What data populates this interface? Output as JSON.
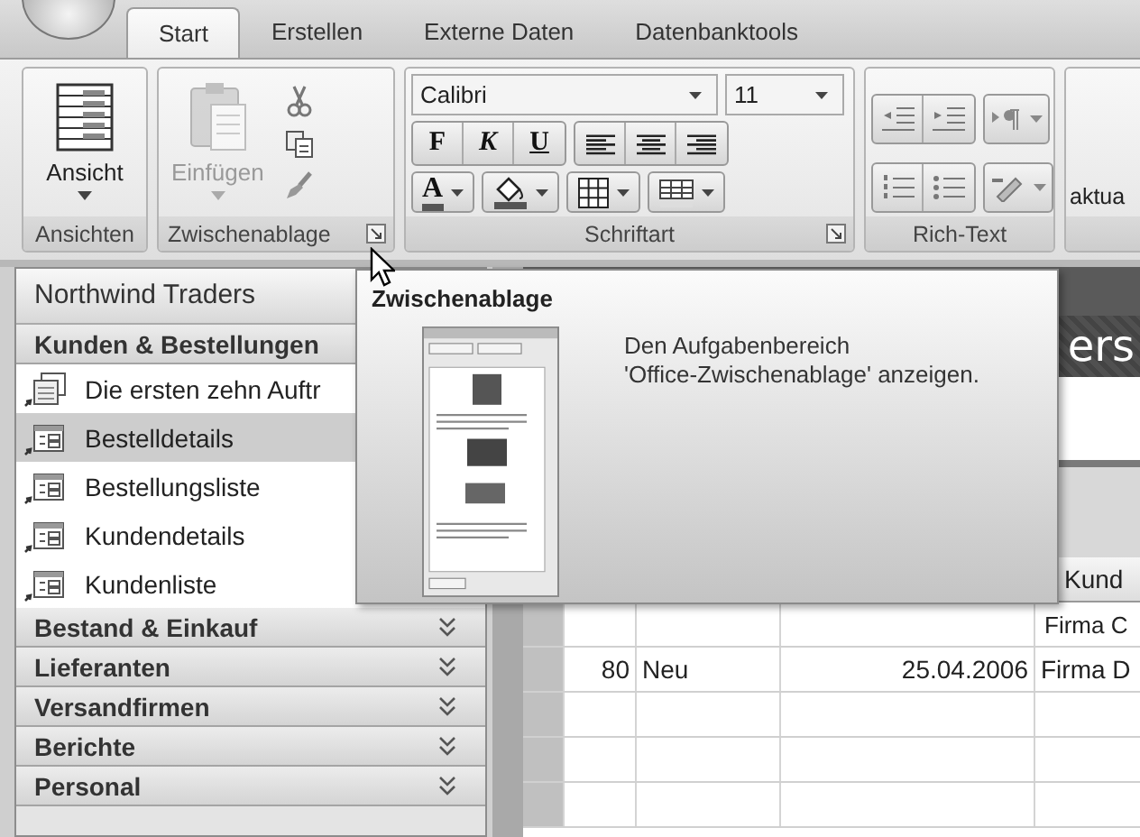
{
  "tabs": [
    {
      "label": "Start",
      "selected": true
    },
    {
      "label": "Erstellen",
      "selected": false
    },
    {
      "label": "Externe Daten",
      "selected": false
    },
    {
      "label": "Datenbanktools",
      "selected": false
    }
  ],
  "ribbon": {
    "groups": [
      {
        "kind": "views",
        "label": "Ansichten",
        "button": {
          "label": "Ansicht",
          "disabled": false
        }
      },
      {
        "kind": "clipboard",
        "label": "Zwischenablage",
        "button": {
          "label": "Einfügen",
          "disabled": true
        }
      },
      {
        "kind": "font",
        "label": "Schriftart",
        "font": "Calibri",
        "size": "11",
        "format_buttons": [
          {
            "label": "F",
            "kind": "bold"
          },
          {
            "label": "K",
            "kind": "italic"
          },
          {
            "label": "U",
            "kind": "underline"
          }
        ],
        "font_color_label": "A"
      },
      {
        "kind": "richtext",
        "label": "Rich-Text"
      },
      {
        "kind": "partial",
        "button_label": "aktua"
      }
    ]
  },
  "nav": {
    "title": "Northwind Traders",
    "groups": [
      {
        "label": "Kunden & Bestellungen",
        "expanded": true,
        "items": [
          {
            "label": "Die ersten zehn Auftr",
            "kind": "split",
            "selected": false
          },
          {
            "label": "Bestelldetails",
            "kind": "form",
            "selected": true
          },
          {
            "label": "Bestellungsliste",
            "kind": "form",
            "selected": false
          },
          {
            "label": "Kundendetails",
            "kind": "form",
            "selected": false
          },
          {
            "label": "Kundenliste",
            "kind": "form",
            "selected": false
          }
        ]
      },
      {
        "label": "Bestand & Einkauf",
        "expanded": false
      },
      {
        "label": "Lieferanten",
        "expanded": false
      },
      {
        "label": "Versandfirmen",
        "expanded": false
      },
      {
        "label": "Berichte",
        "expanded": false
      },
      {
        "label": "Personal",
        "expanded": false
      }
    ]
  },
  "document": {
    "title": "ers",
    "column_4": "Kund",
    "rows": [
      {
        "customer": "Firma C"
      },
      {
        "number": "80",
        "status": "Neu",
        "date": "25.04.2006",
        "customer": "Firma D"
      }
    ]
  },
  "tooltip": {
    "title": "Zwischenablage",
    "text": "Den Aufgabenbereich\n'Office-Zwischenablage' anzeigen."
  }
}
